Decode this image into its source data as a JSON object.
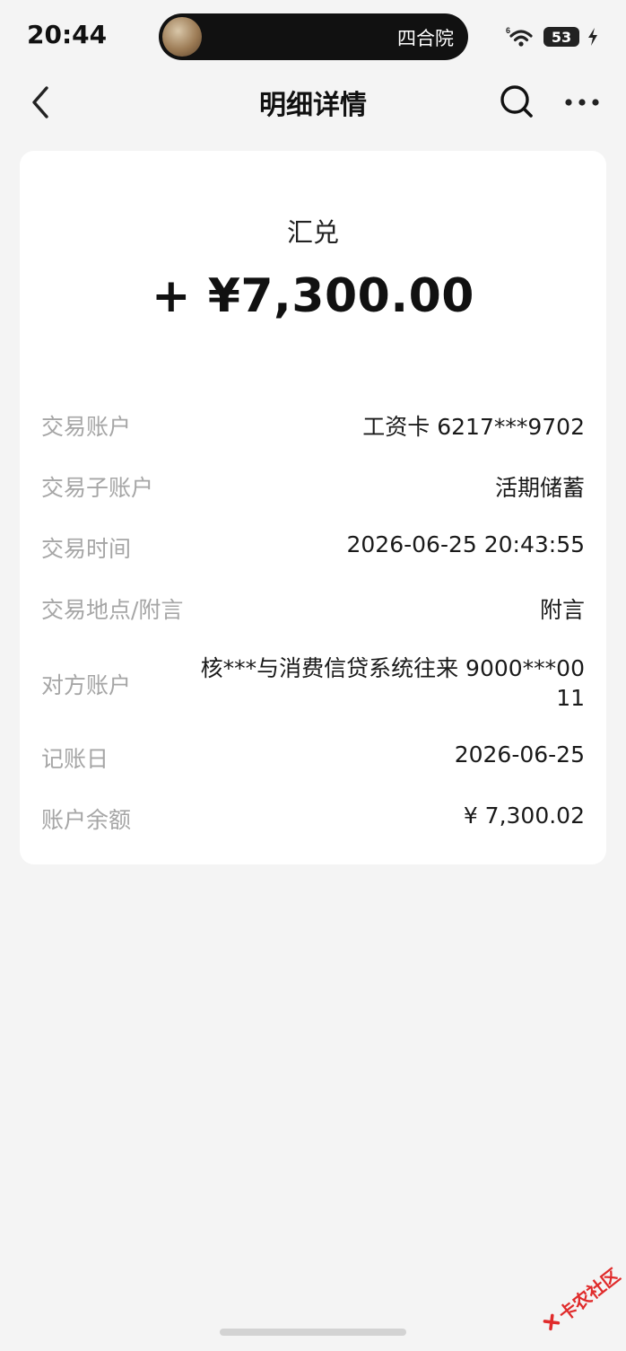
{
  "status_bar": {
    "time": "20:44",
    "island_text": "四合院",
    "battery": "53",
    "network_icon": "wifi-6-icon",
    "charging_icon": "bolt-icon"
  },
  "nav": {
    "title": "明细详情",
    "back_icon": "chevron-left-icon",
    "search_icon": "search-icon",
    "more_icon": "more-dots-icon"
  },
  "transaction": {
    "type": "汇兑",
    "amount": "+ ¥7,300.00"
  },
  "details": [
    {
      "label": "交易账户",
      "value": "工资卡 6217***9702"
    },
    {
      "label": "交易子账户",
      "value": "活期储蓄"
    },
    {
      "label": "交易时间",
      "value": "2026-06-25 20:43:55"
    },
    {
      "label": "交易地点/附言",
      "value": "附言"
    },
    {
      "label": "对方账户",
      "value": "核***与消费信贷系统往来 9000***0011"
    },
    {
      "label": "记账日",
      "value": "2026-06-25"
    },
    {
      "label": "账户余额",
      "value": "¥ 7,300.02"
    }
  ],
  "watermark": {
    "text": "卡农社区",
    "color": "#e02b2b"
  },
  "colors": {
    "background": "#f4f4f4",
    "card": "#ffffff",
    "label": "#a6a6a6",
    "value": "#1a1a1a"
  }
}
